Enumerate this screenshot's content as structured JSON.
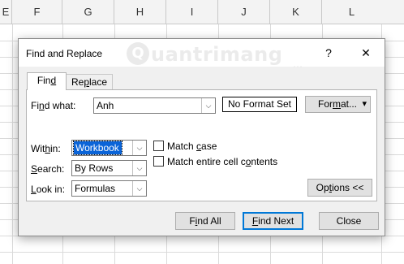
{
  "spreadsheet": {
    "columns": [
      "E",
      "F",
      "G",
      "H",
      "I",
      "J",
      "K",
      "L"
    ]
  },
  "dialog": {
    "title": "Find and Replace",
    "help_label": "?",
    "close_label": "✕",
    "watermark_letter": "Q",
    "watermark_text": "uantrimang",
    "watermark_dots": "···",
    "tabs": [
      {
        "pre": "Fin",
        "key": "d",
        "post": ""
      },
      {
        "pre": "Re",
        "key": "p",
        "post": "lace"
      }
    ],
    "find_what": {
      "label_pre": "Fi",
      "label_key": "n",
      "label_post": "d what:",
      "value": "Anh"
    },
    "format_status": "No Format Set",
    "format_button": {
      "pre": "For",
      "key": "m",
      "post": "at...",
      "arrow": "▾"
    },
    "within": {
      "label_pre": "Wit",
      "label_key": "h",
      "label_post": "in:",
      "value": "Workbook"
    },
    "search": {
      "label_pre": "",
      "label_key": "S",
      "label_post": "earch:",
      "value": "By Rows"
    },
    "look_in": {
      "label_pre": "",
      "label_key": "L",
      "label_post": "ook in:",
      "value": "Formulas"
    },
    "match_case": {
      "pre": "Match ",
      "key": "c",
      "post": "ase",
      "checked": false
    },
    "match_entire": {
      "pre": "Match entire cell c",
      "key": "o",
      "post": "ntents",
      "checked": false
    },
    "options_button": {
      "pre": "Op",
      "key": "t",
      "post": "ions <<"
    },
    "dropdown_arrow": "⌵",
    "find_all_button": {
      "pre": "F",
      "key": "i",
      "post": "nd All"
    },
    "find_next_button": {
      "pre": "",
      "key": "F",
      "post": "ind Next"
    },
    "close_button": "Close"
  }
}
